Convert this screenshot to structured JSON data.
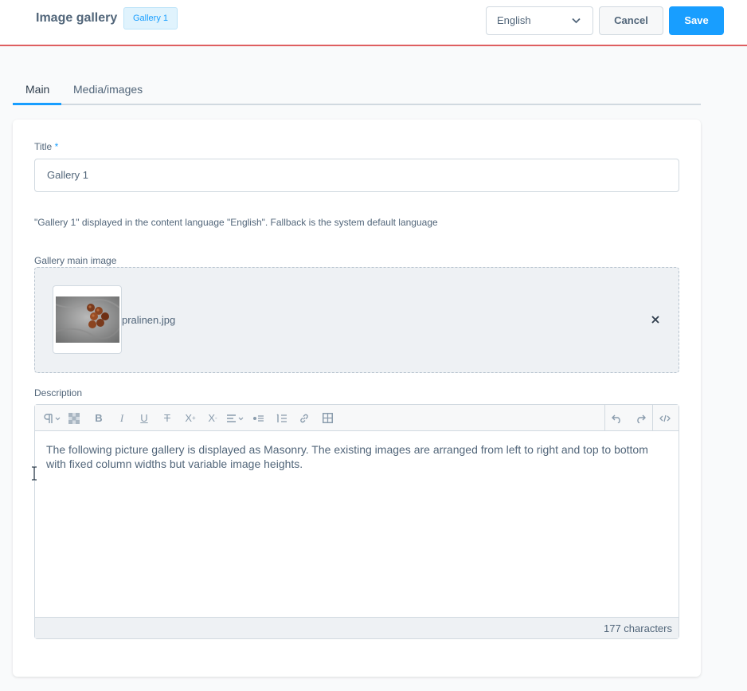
{
  "header": {
    "title": "Image gallery",
    "badge": "Gallery 1",
    "language": "English",
    "cancel_label": "Cancel",
    "save_label": "Save"
  },
  "tabs": [
    {
      "label": "Main",
      "active": true
    },
    {
      "label": "Media/images",
      "active": false
    }
  ],
  "form": {
    "title_label": "Title",
    "title_required_mark": "*",
    "title_value": "Gallery 1",
    "help_text": "\"Gallery 1\" displayed in the content language \"English\". Fallback is the system default language",
    "main_image_label": "Gallery main image",
    "main_image_filename": "pralinen.jpg",
    "description_label": "Description",
    "description_text": "The following picture gallery is displayed as Masonry. The existing images are arranged from left to right and top to bottom with fixed column widths but variable image heights.",
    "character_count": "177 characters"
  },
  "toolbar_icons": [
    "paragraph-icon",
    "clear-format-icon",
    "bold-icon",
    "italic-icon",
    "underline-icon",
    "strikethrough-icon",
    "superscript-icon",
    "subscript-icon",
    "align-icon",
    "bullet-list-icon",
    "numbered-list-icon",
    "link-icon",
    "table-icon",
    "undo-icon",
    "redo-icon",
    "code-view-icon"
  ],
  "colors": {
    "accent": "#189eff",
    "header_border": "#de5e60",
    "text": "#52667a"
  }
}
